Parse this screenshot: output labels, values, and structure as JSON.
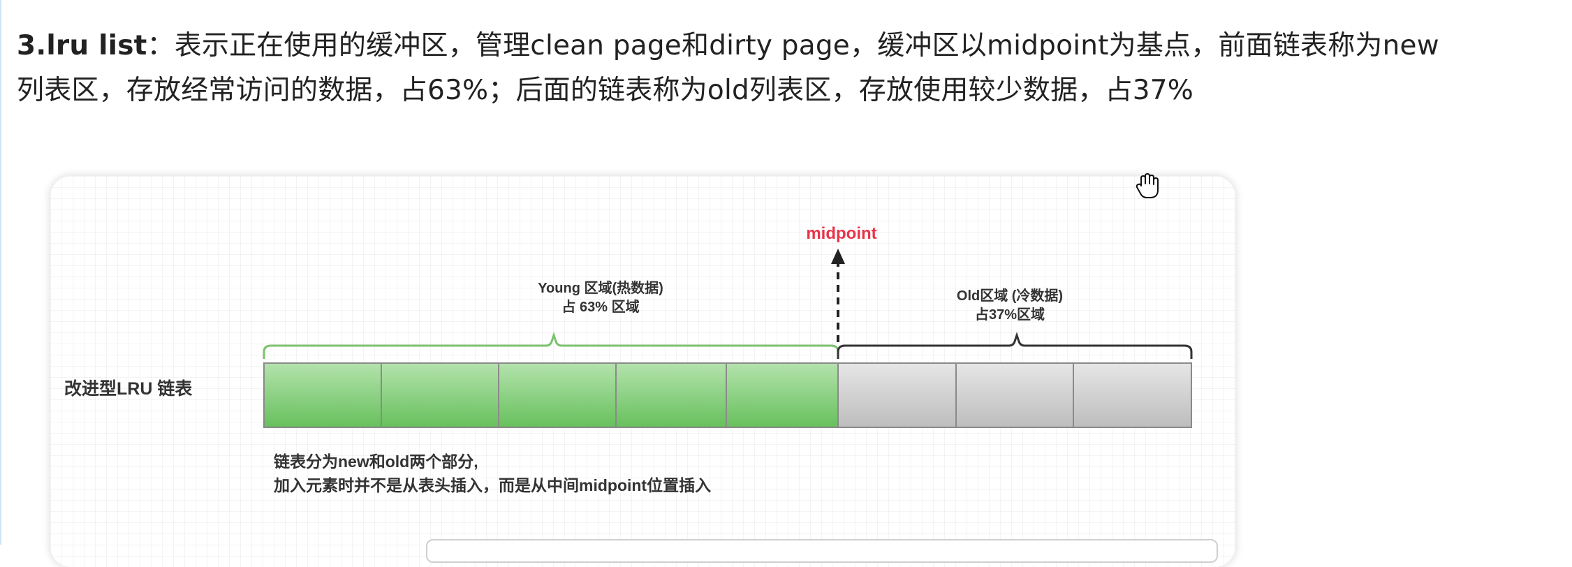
{
  "paragraph": {
    "term": "3.lru list",
    "line1_rest": "：表示正在使用的缓冲区，管理clean page和dirty page，缓冲区以midpoint为基点，前面链表称为new",
    "line2": "列表区，存放经常访问的数据，占63%；后面的链表称为old列表区，存放使用较少数据，占37%"
  },
  "diagram": {
    "midpoint_label": "midpoint",
    "young_label_line1": "Young 区域(热数据)",
    "young_label_line2": "占 63% 区域",
    "old_label_line1": "Old区域 (冷数据)",
    "old_label_line2": "占37%区域",
    "list_label": "改进型LRU 链表",
    "note_line1": "链表分为new和old两个部分,",
    "note_line2": "加入元素时并不是从表头插入，而是从中间midpoint位置插入",
    "young_cells": 5,
    "old_cells": 3,
    "colors": {
      "young_fill_top": "#b4e3ad",
      "young_fill_bottom": "#67c05c",
      "old_fill_top": "#e6e6e6",
      "old_fill_bottom": "#bdbdbd",
      "young_brace": "#7cc26f",
      "old_brace": "#333333",
      "midpoint": "#e8344a"
    }
  },
  "cursor_icon": "hand-grab-icon"
}
